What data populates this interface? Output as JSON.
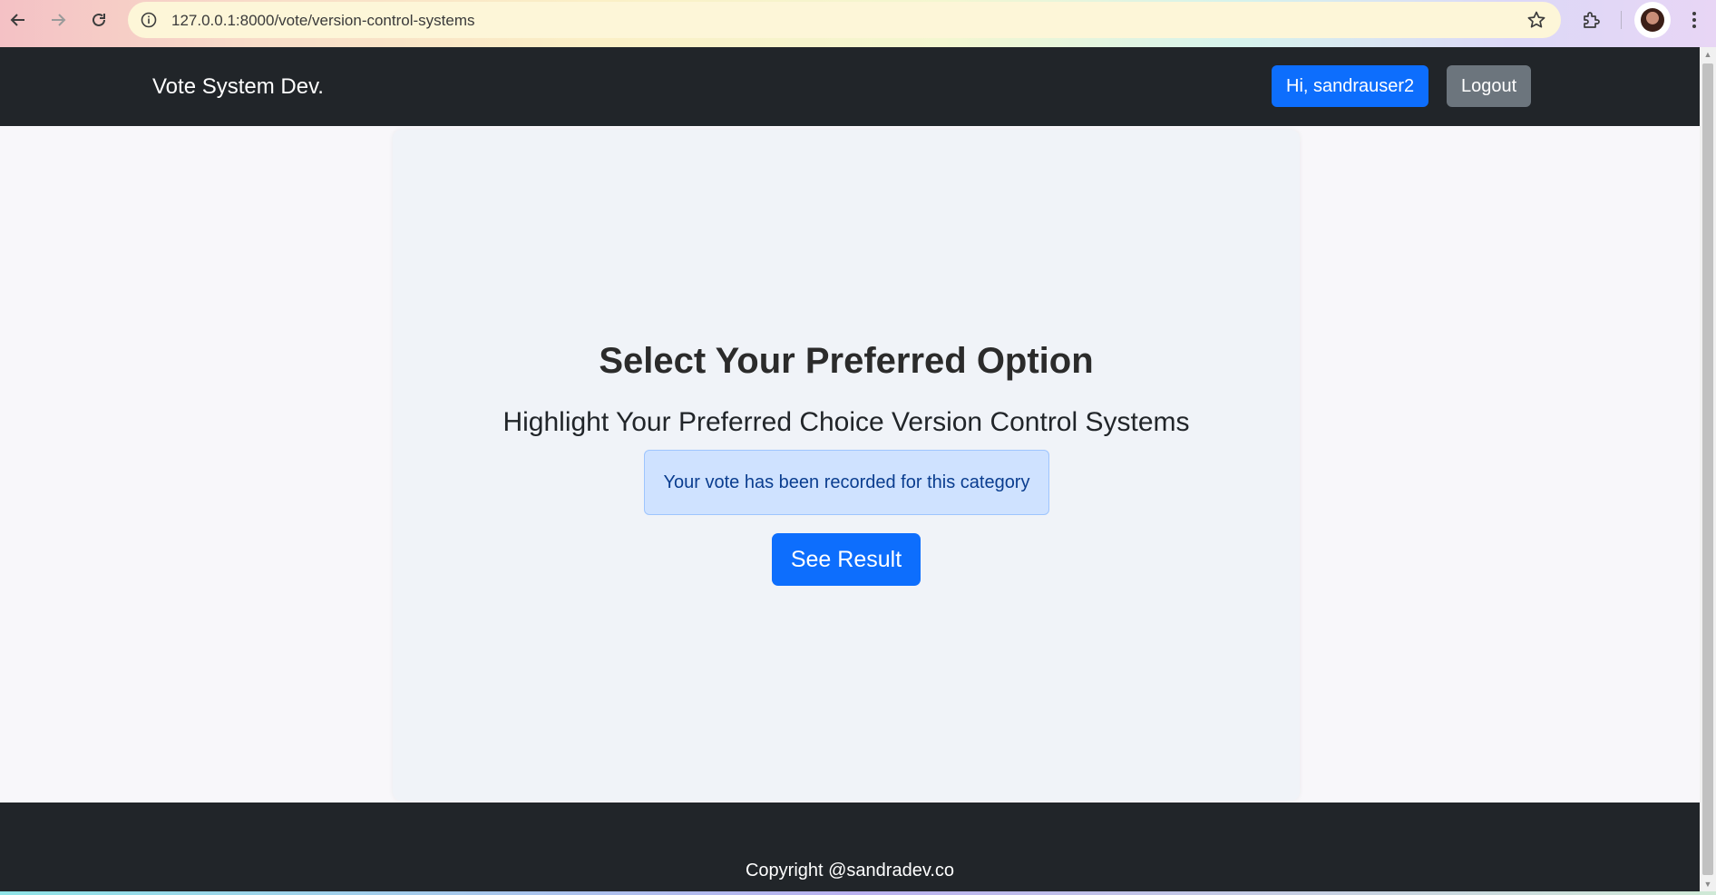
{
  "browser": {
    "url": "127.0.0.1:8000/vote/version-control-systems"
  },
  "navbar": {
    "brand": "Vote System Dev.",
    "greeting": "Hi, sandrauser2",
    "logout_label": "Logout"
  },
  "main": {
    "title": "Select Your Preferred Option",
    "subtitle": "Highlight Your Preferred Choice Version Control Systems",
    "alert": "Your vote has been recorded for this category",
    "result_button": "See Result"
  },
  "footer": {
    "copyright": "Copyright @sandradev.co"
  },
  "colors": {
    "navbar_bg": "#212529",
    "primary": "#0d6efd",
    "secondary": "#6c757d",
    "alert_bg": "#cfe2ff"
  }
}
